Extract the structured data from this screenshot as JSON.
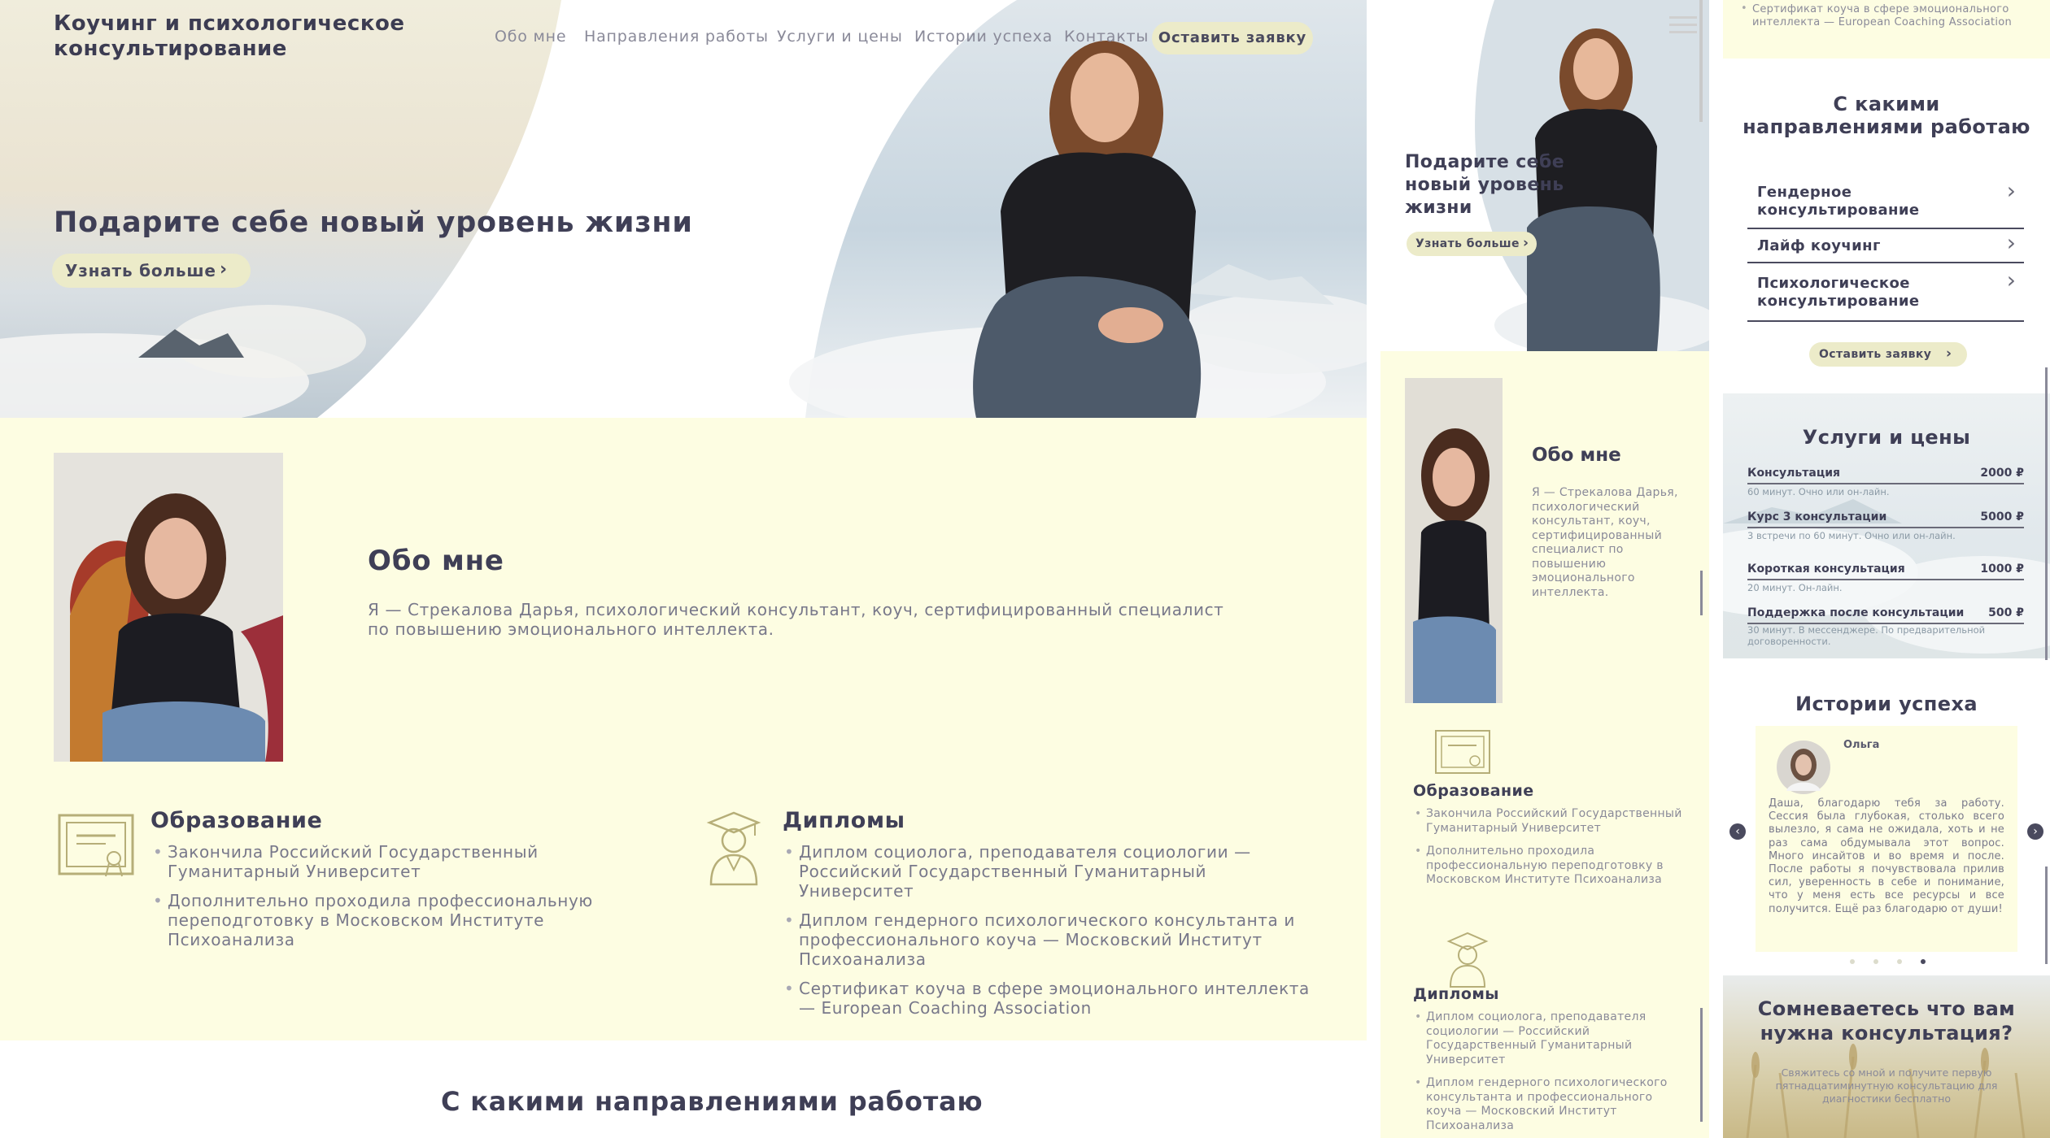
{
  "desktop": {
    "logo": "Коучинг и психологическое консультирование",
    "nav": [
      "Обо мне",
      "Направления работы",
      "Услуги и цены",
      "Истории успеха",
      "Контакты"
    ],
    "cta_label": "Оставить заявку",
    "hero_title": "Подарите себе новый уровень жизни",
    "hero_button": "Узнать больше",
    "about_title": "Обо мне",
    "about_text": "Я — Стрекалова Дарья, психологический консультант, коуч, сертифицированный специалист по повышению эмоционального интеллекта.",
    "education_title": "Образование",
    "education": [
      "Закончила Российский Государственный Гуманитарный Университет",
      "Дополнительно проходила профессиональную переподготовку в Московском Институте Психоанализа"
    ],
    "diplomas_title": "Дипломы",
    "diplomas": [
      "Диплом социолога, преподавателя социологии — Российский Государственный Гуманитарный Университет",
      "Диплом гендерного психологического консультанта и профессионального коуча — Московский Институт Психоанализа",
      "Сертификат коуча в сфере эмоционального интеллекта — European Coaching Association"
    ],
    "directions_title": "С какими направлениями работаю"
  },
  "mobile1": {
    "hero_title": "Подарите себе новый уровень жизни",
    "hero_button": "Узнать больше",
    "about_title": "Обо мне",
    "about_text": "Я — Стрекалова Дарья, психологический консультант, коуч, сертифицированный специалист по повышению эмоционального интеллекта.",
    "education_title": "Образование",
    "education": [
      "Закончила Российский Государственный Гуманитарный Университет",
      "Дополнительно проходила профессиональную переподготовку в Московском Институте Психоанализа"
    ],
    "diplomas_title": "Дипломы",
    "diplomas": [
      "Диплом социолога, преподавателя социологии — Российский Государственный Гуманитарный Университет",
      "Диплом гендерного психологического консультанта и профессионального коуча — Московский Институт Психоанализа"
    ]
  },
  "mobile2": {
    "top_bullet": "Сертификат коуча в сфере эмоционального интеллекта — European Coaching Association",
    "directions_title": "С какими направлениями работаю",
    "directions": [
      "Гендерное консультирование",
      "Лайф коучинг",
      "Психологическое консультирование"
    ],
    "cta_label": "Оставить заявку",
    "services_title": "Услуги и цены",
    "services": [
      {
        "name": "Консультация",
        "price": "2000 ₽",
        "note": "60 минут. Очно или он-лайн."
      },
      {
        "name": "Курс 3 консультации",
        "price": "5000 ₽",
        "note": "3 встречи по 60 минут. Очно или он-лайн."
      },
      {
        "name": "Короткая консультация",
        "price": "1000 ₽",
        "note": "20 минут. Он-лайн."
      },
      {
        "name": "Поддержка после консультации",
        "price": "500 ₽",
        "note": "30 минут. В мессенджере. По предварительной договоренности."
      }
    ],
    "stories_title": "Истории успеха",
    "story_name": "Ольга",
    "story_text": "Даша, благодарю тебя за работу. Сессия была глубокая, столько всего вылезло, я сама не ожидала, хоть и не раз сама обдумывала этот вопрос. Много инсайтов и во время и после. После работы я почувствовала прилив сил, уверенность в себе и понимание, что у меня есть все ресурсы и все получится. Ещё раз благодарю от души!",
    "doubt_title": "Сомневаетесь что вам нужна консультация?",
    "doubt_text": "Свяжитесь со мной и получите первую пятнадцатиминутную консультацию для диагностики бесплатно"
  },
  "colors": {
    "accent_bg": "#fdfde2",
    "button_bg": "#ecebc9",
    "text_dark": "#3f3f56",
    "text_muted": "#78788a"
  }
}
